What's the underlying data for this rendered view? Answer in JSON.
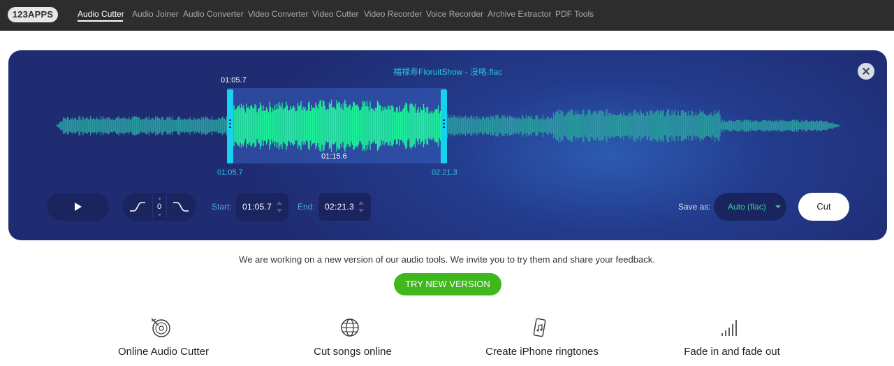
{
  "nav": {
    "logo": "123APPS",
    "items": [
      {
        "label": "Audio Cutter",
        "active": true
      },
      {
        "label": "Audio Joiner"
      },
      {
        "label": "Audio Converter"
      },
      {
        "label": "Video Converter"
      },
      {
        "label": "Video Cutter"
      },
      {
        "label": "Video Recorder"
      },
      {
        "label": "Voice Recorder"
      },
      {
        "label": "Archive Extractor"
      },
      {
        "label": "PDF Tools"
      }
    ]
  },
  "editor": {
    "filename": "福禄寿FloruitShow - 没咯.flac",
    "selection_start_top": "01:05.7",
    "selection_start_bottom": "01:05.7",
    "selection_middle": "01:15.6",
    "selection_end_bottom": "02:21.3",
    "fade_value": "0",
    "start_label": "Start:",
    "start_value": "01:05.7",
    "end_label": "End:",
    "end_value": "02:21.3",
    "save_as_label": "Save as:",
    "format_value": "Auto (flac)",
    "cut_label": "Cut"
  },
  "notice": {
    "text": "We are working on a new version of our audio tools. We invite you to try them and share your feedback.",
    "button_label": "TRY NEW VERSION"
  },
  "features": [
    {
      "title": "Online Audio Cutter",
      "icon": "vinyl-cut-icon"
    },
    {
      "title": "Cut songs online",
      "icon": "globe-icon"
    },
    {
      "title": "Create iPhone ringtones",
      "icon": "phone-ringtone-icon"
    },
    {
      "title": "Fade in and fade out",
      "icon": "volume-bars-icon"
    }
  ],
  "colors": {
    "selected_wave": "#1ef59a",
    "unselected_wave": "#2a9aa0",
    "handle": "#17d2ef",
    "accent_green": "#3fb71f"
  }
}
